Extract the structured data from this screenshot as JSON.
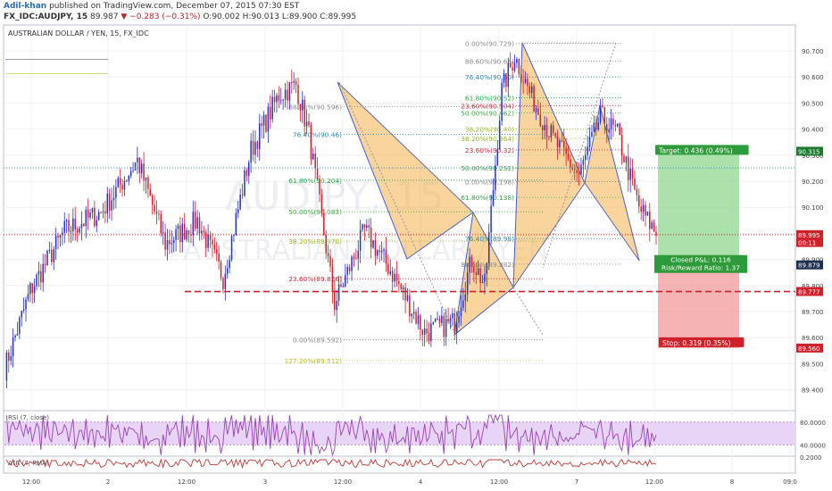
{
  "header": {
    "author": "Adil-khan",
    "published_text": "published on TradingView.com, December 07, 2015 07:30 EST",
    "symbol": "FX_IDC:AUDJPY, 15",
    "last": "89.987",
    "change": "▼ −0.283 (−0.31%)",
    "ohlc": "O:90.002 H:90.013 L:89.900 C:89.995"
  },
  "chart_title": "AUSTRALIAN DOLLAR / YEN, 15, FX_IDC",
  "watermark": {
    "symbol": "AUDJPY, 15",
    "name": "AUSTRALIAN DOLLAR / YEN"
  },
  "colors": {
    "up": "#2233cc",
    "down": "#d0202a",
    "pattern": "#f5b04c",
    "target": "#8fd88f",
    "stop": "#f29a9a",
    "rsi_band": "#e8d4f4",
    "rsi_line": "#9a40b8",
    "atr_line": "#c23a3a"
  },
  "chart_data": {
    "type": "candlestick",
    "ylim": [
      89.3,
      90.8
    ],
    "price_ticks": [
      "90.700",
      "90.600",
      "90.500",
      "90.400",
      "90.300",
      "90.200",
      "90.100",
      "90.000",
      "89.900",
      "89.800",
      "89.700",
      "89.600",
      "89.500",
      "89.400"
    ],
    "time_ticks": [
      "12:00",
      "2",
      "12:00",
      "3",
      "12:00",
      "4",
      "12:00",
      "7",
      "12:00",
      "8",
      "09:0"
    ],
    "anchors": [
      {
        "i": 0,
        "p": 89.48
      },
      {
        "i": 12,
        "p": 89.78
      },
      {
        "i": 28,
        "p": 90.01
      },
      {
        "i": 45,
        "p": 90.08
      },
      {
        "i": 62,
        "p": 90.28
      },
      {
        "i": 75,
        "p": 89.96
      },
      {
        "i": 90,
        "p": 90.05
      },
      {
        "i": 102,
        "p": 89.83
      },
      {
        "i": 115,
        "p": 90.32
      },
      {
        "i": 128,
        "p": 90.53
      },
      {
        "i": 136,
        "p": 90.57
      },
      {
        "i": 142,
        "p": 90.38
      },
      {
        "i": 154,
        "p": 89.73
      },
      {
        "i": 168,
        "p": 90.01
      },
      {
        "i": 180,
        "p": 89.86
      },
      {
        "i": 196,
        "p": 89.62
      },
      {
        "i": 210,
        "p": 89.66
      },
      {
        "i": 218,
        "p": 89.9
      },
      {
        "i": 224,
        "p": 89.8
      },
      {
        "i": 232,
        "p": 90.55
      },
      {
        "i": 238,
        "p": 90.68
      },
      {
        "i": 246,
        "p": 90.52
      },
      {
        "i": 256,
        "p": 90.36
      },
      {
        "i": 268,
        "p": 90.22
      },
      {
        "i": 278,
        "p": 90.45
      },
      {
        "i": 286,
        "p": 90.38
      },
      {
        "i": 296,
        "p": 90.1
      },
      {
        "i": 304,
        "p": 90.0
      }
    ],
    "harmonic_patterns": [
      {
        "name": "left",
        "points": [
          [
            377,
            89.43
          ],
          [
            456,
            90.56
          ],
          [
            600,
            89.01
          ],
          [
            680,
            88.28
          ],
          [
            745,
            89.68
          ]
        ]
      },
      {
        "name": "right",
        "points": [
          [
            744,
            89.68
          ],
          [
            860,
            89.9
          ],
          [
            940,
            89.36
          ],
          [
            1000,
            89.92
          ],
          [
            1030,
            89.28
          ]
        ]
      }
    ],
    "fib_left": [
      {
        "label": "88.60%(90.596)",
        "price": 90.486
      },
      {
        "label": "76.40%(90.46)",
        "price": 90.38
      },
      {
        "label": "61.80%(90.204)",
        "price": 90.204
      },
      {
        "label": "50.00%(90.083)",
        "price": 90.083
      },
      {
        "label": "38.20%(89.970)",
        "price": 89.97
      },
      {
        "label": "23.60%(89.826)",
        "price": 89.826
      },
      {
        "label": "0.00%(89.592)",
        "price": 89.592
      },
      {
        "label": "127.20%(89.512)",
        "price": 89.512
      }
    ],
    "fib_right": [
      {
        "label": "0.00%(90.729)",
        "price": 90.729
      },
      {
        "label": "88.60%(90.66)",
        "price": 90.66
      },
      {
        "label": "76.40%(90.60)",
        "price": 90.6
      },
      {
        "label": "61.80%(90.52)",
        "price": 90.52
      },
      {
        "label": "23.60%(90.504)",
        "price": 90.49
      },
      {
        "label": "50.00%(90.462)",
        "price": 90.462
      },
      {
        "label": "38.20%(90.40)",
        "price": 90.4
      },
      {
        "label": "38.20%(90.364)",
        "price": 90.364
      },
      {
        "label": "23.60%(90.32)",
        "price": 90.32
      },
      {
        "label": "50.00%(90.251)",
        "price": 90.251
      },
      {
        "label": "0.00%(90.198)",
        "price": 90.198
      },
      {
        "label": "61.80%(90.138)",
        "price": 90.138
      },
      {
        "label": "76.40%(89.98)",
        "price": 89.98
      },
      {
        "label": "88.60%(89.882)",
        "price": 89.882
      }
    ],
    "price_badges": [
      {
        "text": "90.315",
        "price": 90.315,
        "color": "#1f7a30"
      },
      {
        "text": "89.995",
        "price": 89.995,
        "color": "#d0202a"
      },
      {
        "text": "00:11",
        "price": 89.965,
        "color": "#d0202a"
      },
      {
        "text": "89.879",
        "price": 89.879,
        "color": "#1f2f4f"
      },
      {
        "text": "89.777",
        "price": 89.777,
        "color": "#d0202a"
      },
      {
        "text": "89.560",
        "price": 89.56,
        "color": "#d0202a"
      }
    ],
    "position": {
      "entry": 89.879,
      "target": 90.315,
      "stop": 89.56,
      "target_label": "Target: 0.436 (0.49%)",
      "stop_label": "Stop: 0.319 (0.35%)",
      "pnl_label": "Closed P&L: 0.116",
      "rr_label": "Risk/Reward Ratio: 1.37"
    },
    "support_level": 89.777,
    "dotted_level": 90.251,
    "rsi": {
      "label": "RSI (7, close)",
      "ticks": [
        "80.0000",
        "40.0000"
      ],
      "range": [
        20,
        100
      ],
      "band": [
        40,
        80
      ]
    },
    "atr": {
      "label": "ATR (7, RMA)",
      "ticks": [
        "0.2000"
      ]
    }
  }
}
